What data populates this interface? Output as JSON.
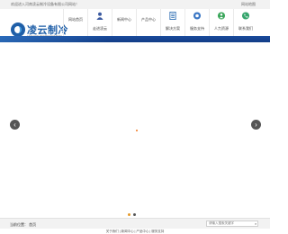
{
  "topbar": {
    "welcome": "欢迎进入河南凌云制冷设备有限公司网站！",
    "sitemap": "网站地图"
  },
  "logo": {
    "name": "凌云制冷",
    "subtitle": "LINGYUN REFRIGERATION"
  },
  "nav": {
    "items": [
      {
        "label": "网站首页",
        "icon": null
      },
      {
        "label": "走进凌云",
        "icon": "user-icon",
        "color": "#3b5aa0"
      },
      {
        "label": "新闻中心",
        "icon": null
      },
      {
        "label": "产品中心",
        "icon": null
      },
      {
        "label": "解决方案",
        "icon": "document-icon",
        "color": "#2f6fb3"
      },
      {
        "label": "服务支持",
        "icon": "support-icon",
        "color": "#3b77c4"
      },
      {
        "label": "人力资源",
        "icon": "people-icon",
        "color": "#3aa65a"
      },
      {
        "label": "联系我们",
        "icon": "phone-icon",
        "color": "#35a56c"
      }
    ]
  },
  "banner": {
    "prev": "‹",
    "next": "›",
    "dots": 2
  },
  "crumbs": {
    "location": "当前位置： 首页",
    "search_placeholder": "请输入搜索关键字",
    "search_icon": "search-icon"
  },
  "footer": {
    "links": "关于我们 | 新闻中心 | 产品中心 | 服务支持"
  }
}
